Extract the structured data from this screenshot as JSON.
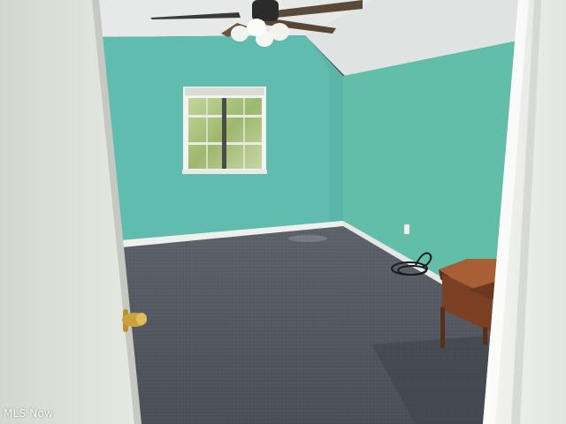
{
  "watermark": {
    "text": "MLS Now"
  },
  "colors": {
    "wall_left": "#5fbcae",
    "wall_right": "#62bda9",
    "ceiling": "#e9eceb",
    "carpet": "#565b63",
    "door": "#dfe2dc",
    "door_frame": "#eef0ec",
    "trim": "#f2f3ef",
    "window_view": "#a9c27a",
    "table_wood": "#8a4a2c",
    "knob_brass": "#c8a03a"
  }
}
